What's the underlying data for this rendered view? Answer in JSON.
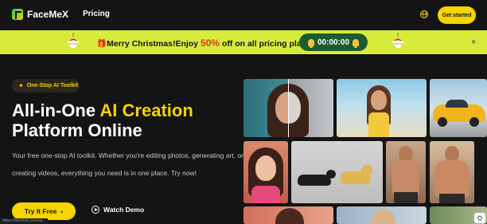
{
  "nav": {
    "brand": "FaceMeX",
    "links": [
      "Pricing"
    ],
    "cta": "Get started"
  },
  "banner": {
    "text_before": "Merry Christmas!Enjoy ",
    "discount": "50%",
    "text_after": " off on all pricing plans!",
    "timer": "00:00:00",
    "close": "×"
  },
  "hero": {
    "badge": "One-Stop AI Toolkit",
    "title_part1": "All-in-One ",
    "title_accent": "AI Creation",
    "title_line2": "Platform Online",
    "description": "Your free one-stop AI toolkit. Whether you're editing photos, generating art, or creating videos, everything you need is in one place. Try now!",
    "primary_button": "Try It Free",
    "primary_arrow": "›",
    "secondary_button": "Watch Demo"
  },
  "status_bar": {
    "url": "https://facemex.com/ai..."
  },
  "colors": {
    "background": "#141414",
    "accent_yellow": "#f5d400",
    "banner_green": "#d7ec3a",
    "timer_green": "#1c5a2f",
    "discount_red": "#e0371c"
  }
}
